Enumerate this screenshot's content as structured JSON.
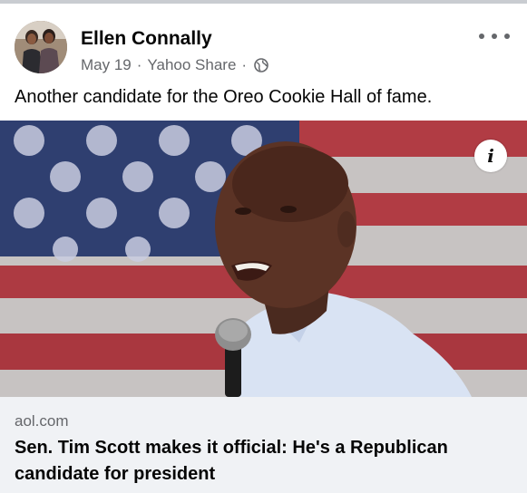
{
  "post": {
    "author": "Ellen Connally",
    "date": "May 19",
    "source": "Yahoo Share",
    "separator": "·",
    "privacy_icon": "globe-icon",
    "more_icon": "more-options-icon",
    "text": "Another candidate for the Oreo Cookie Hall of fame."
  },
  "link_preview": {
    "domain": "aol.com",
    "headline": "Sen. Tim Scott makes it official: He's a Republican candidate for president",
    "info_glyph": "i"
  },
  "colors": {
    "background": "#ffffff",
    "link_box": "#f0f2f5",
    "secondary_text": "#65676b",
    "primary_text": "#050505",
    "flag_blue": "#2f3f70",
    "flag_red": "#a8353c"
  }
}
